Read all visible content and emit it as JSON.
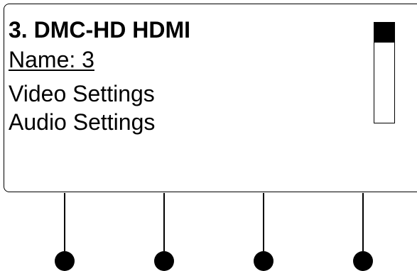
{
  "screen": {
    "title": "3. DMC-HD HDMI",
    "items": [
      {
        "label": "Name: 3",
        "selected": true
      },
      {
        "label": "Video Settings",
        "selected": false
      },
      {
        "label": "Audio Settings",
        "selected": false
      }
    ]
  },
  "scrollbar": {
    "thumb_fraction": 0.2,
    "position": "top"
  },
  "softkeys": {
    "count": 4
  }
}
